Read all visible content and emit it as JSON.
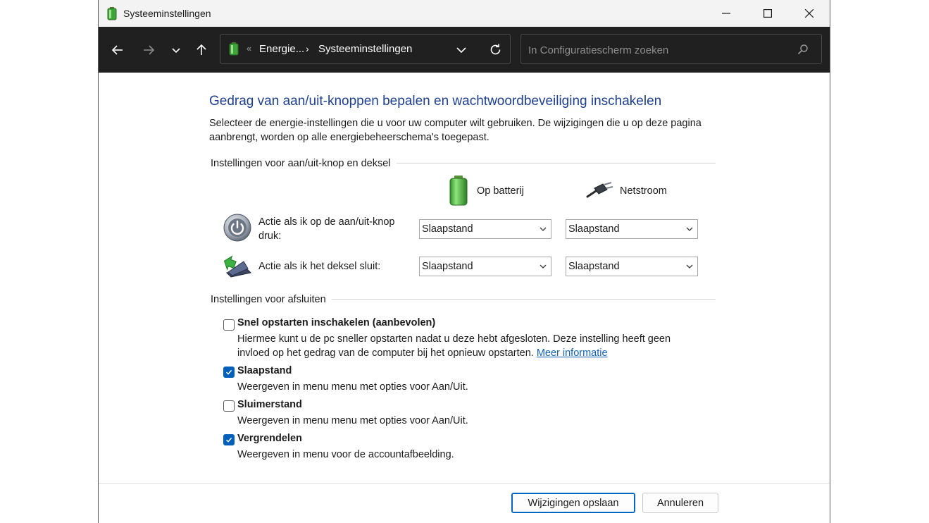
{
  "window": {
    "title": "Systeeminstellingen",
    "controls": {
      "minimize": "minimize-icon",
      "maximize": "maximize-icon",
      "close": "close-icon"
    }
  },
  "navigation": {
    "back": "arrow-left-icon",
    "forward": "arrow-right-icon",
    "recent": "chevron-down-icon",
    "up": "arrow-up-icon"
  },
  "address": {
    "overflow": "«",
    "segment_1": "Energie...",
    "separator": "›",
    "segment_2": "Systeeminstellingen"
  },
  "search": {
    "placeholder": "In Configuratiescherm zoeken",
    "value": ""
  },
  "page": {
    "heading": "Gedrag van aan/uit-knoppen bepalen en wachtwoordbeveiliging inschakelen",
    "description": "Selecteer de energie-instellingen die u voor uw computer wilt gebruiken. De wijzigingen die u op deze pagina aanbrengt, worden op alle energiebeheerschema's toegepast."
  },
  "power_section": {
    "label": "Instellingen voor aan/uit-knop en deksel",
    "column_battery": "Op batterij",
    "column_ac": "Netstroom",
    "rows": [
      {
        "label": "Actie als ik op de aan/uit-knop druk:",
        "battery": "Slaapstand",
        "ac": "Slaapstand",
        "icon": "power-button-icon"
      },
      {
        "label": "Actie als ik het deksel sluit:",
        "battery": "Slaapstand",
        "ac": "Slaapstand",
        "icon": "laptop-lid-icon"
      }
    ]
  },
  "shutdown_section": {
    "label": "Instellingen voor afsluiten",
    "options": [
      {
        "title": "Snel opstarten inschakelen (aanbevolen)",
        "desc": "Hiermee kunt u de pc sneller opstarten nadat u deze hebt afgesloten. Deze instelling heeft geen invloed op het gedrag van de computer bij het opnieuw opstarten.",
        "link": "Meer informatie",
        "checked": false
      },
      {
        "title": "Slaapstand",
        "desc": "Weergeven in menu menu met opties voor Aan/Uit.",
        "checked": true
      },
      {
        "title": "Sluimerstand",
        "desc": "Weergeven in menu menu met opties voor Aan/Uit.",
        "checked": false
      },
      {
        "title": "Vergrendelen",
        "desc": "Weergeven in menu voor de accountafbeelding.",
        "checked": true
      }
    ]
  },
  "footer": {
    "save": "Wijzigingen opslaan",
    "cancel": "Annuleren"
  },
  "colors": {
    "accent": "#005fb8",
    "heading": "#1e3f8f",
    "navbar": "#202020"
  }
}
